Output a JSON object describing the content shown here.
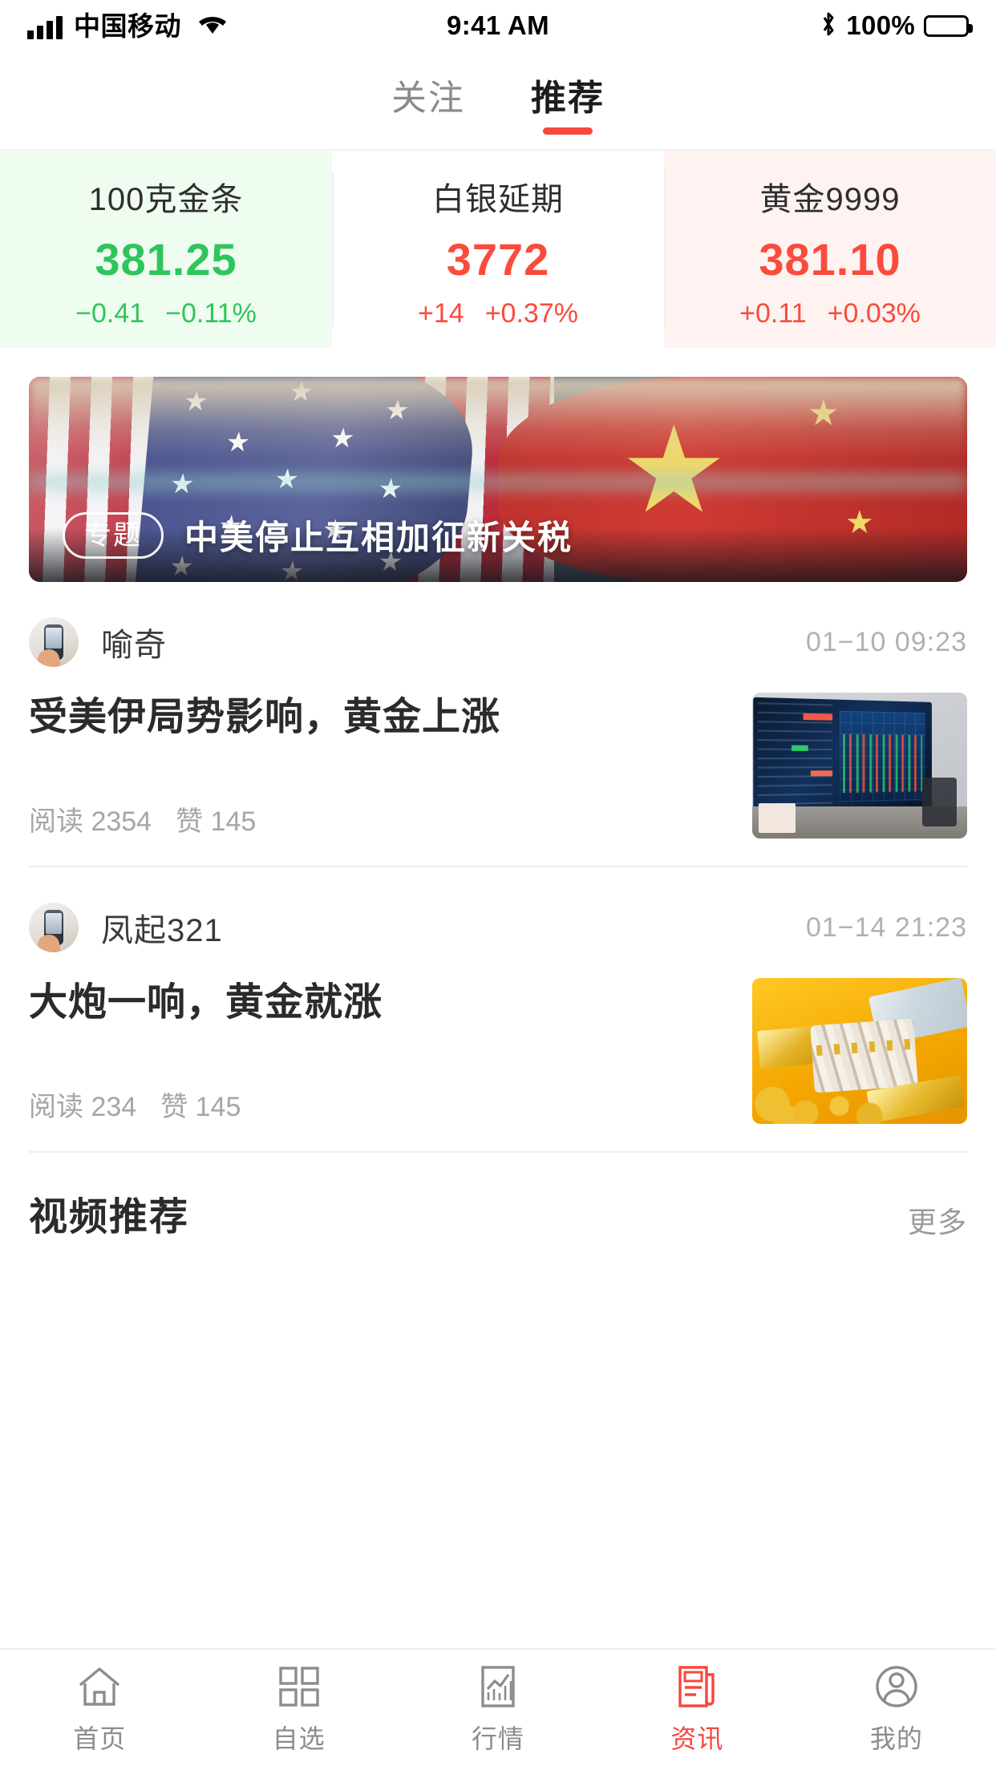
{
  "statusbar": {
    "carrier": "中国移动",
    "time": "9:41 AM",
    "battery_pct": "100%",
    "bluetooth_icon": "bluetooth-icon",
    "wifi_icon": "wifi-icon",
    "signal_icon": "signal-bars-icon"
  },
  "top_tabs": [
    {
      "label": "关注",
      "active": false
    },
    {
      "label": "推荐",
      "active": true
    }
  ],
  "quotes": [
    {
      "name": "100克金条",
      "price": "381.25",
      "change": "−0.41",
      "change_pct": "−0.11%",
      "direction": "down",
      "color": "#2fc55c",
      "bg": "#effcf0"
    },
    {
      "name": "白银延期",
      "price": "3772",
      "change": "+14",
      "change_pct": "+0.37%",
      "direction": "up",
      "color": "#fa4b3c",
      "bg": "#ffffff"
    },
    {
      "name": "黄金9999",
      "price": "381.10",
      "change": "+0.11",
      "change_pct": "+0.03%",
      "direction": "up",
      "color": "#fa4b3c",
      "bg": "#fef3f1"
    }
  ],
  "banner": {
    "badge": "专题",
    "title": "中美停止互相加征新关税",
    "image_alt": "us-china-flags-photo"
  },
  "articles": [
    {
      "author": "喻奇",
      "time": "01−10 09:23",
      "title": "受美伊局势影响，黄金上涨",
      "read_label": "阅读",
      "read_count": "2354",
      "like_label": "赞",
      "like_count": "145",
      "thumb_alt": "trading-monitor-photo"
    },
    {
      "author": "凤起321",
      "time": "01−14 21:23",
      "title": "大炮一响，黄金就涨",
      "read_label": "阅读",
      "read_count": "234",
      "like_label": "赞",
      "like_count": "145",
      "thumb_alt": "gold-bars-cash-photo"
    }
  ],
  "video_section": {
    "title": "视频推荐",
    "more": "更多"
  },
  "tabbar": [
    {
      "label": "首页",
      "icon": "home-icon",
      "active": false
    },
    {
      "label": "自选",
      "icon": "grid-icon",
      "active": false
    },
    {
      "label": "行情",
      "icon": "chart-icon",
      "active": false
    },
    {
      "label": "资讯",
      "icon": "news-icon",
      "active": true
    },
    {
      "label": "我的",
      "icon": "user-icon",
      "active": false
    }
  ],
  "theme": {
    "accent": "#f5483f",
    "up": "#fa4b3c",
    "down": "#2fc55c"
  }
}
